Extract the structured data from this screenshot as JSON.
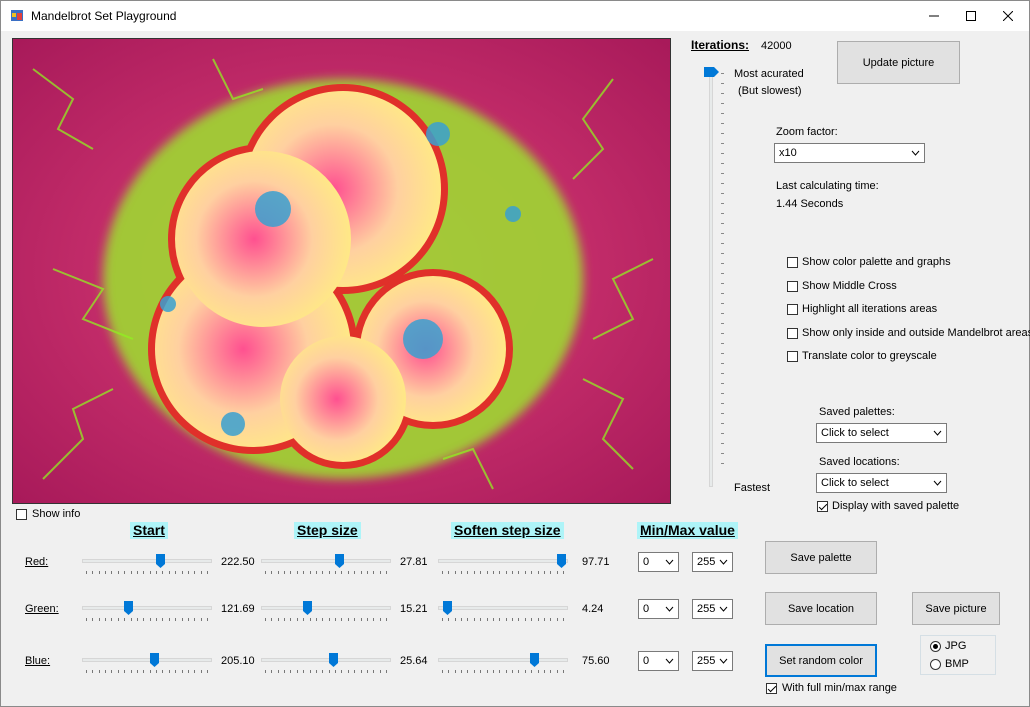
{
  "window": {
    "title": "Mandelbrot Set Playground"
  },
  "iterations": {
    "label": "Iterations:",
    "value": "42000",
    "most": "Most acurated",
    "slowest": "(But slowest)",
    "fastest": "Fastest",
    "level": 1.0
  },
  "update_button": "Update picture",
  "zoom": {
    "label": "Zoom factor:",
    "value": "x10"
  },
  "calc": {
    "label": "Last calculating time:",
    "value": "1.44 Seconds"
  },
  "options": [
    {
      "label": "Show color palette and graphs",
      "checked": false
    },
    {
      "label": "Show Middle Cross",
      "checked": false
    },
    {
      "label": "Highlight all iterations areas",
      "checked": false
    },
    {
      "label": "Show only inside and outside Mandelbrot areas",
      "checked": false
    },
    {
      "label": "Translate color to greyscale",
      "checked": false
    }
  ],
  "saved_palettes": {
    "label": "Saved palettes:",
    "value": "Click to select"
  },
  "saved_locations": {
    "label": "Saved locations:",
    "value": "Click to select"
  },
  "display_saved_palette": {
    "label": "Display with saved palette",
    "checked": true
  },
  "show_info": {
    "label": "Show info",
    "checked": false
  },
  "headers": {
    "start": "Start",
    "step": "Step size",
    "soften": "Soften step size",
    "minmax": "Min/Max value"
  },
  "channels": [
    {
      "name": "Red:",
      "start": "222.50",
      "start_level": 0.61,
      "step": "27.81",
      "step_level": 0.61,
      "soften": "97.71",
      "soften_level": 0.98,
      "min": "0",
      "max": "255"
    },
    {
      "name": "Green:",
      "start": "121.69",
      "start_level": 0.35,
      "step": "15.21",
      "step_level": 0.35,
      "soften": "4.24",
      "soften_level": 0.04,
      "min": "0",
      "max": "255"
    },
    {
      "name": "Blue:",
      "start": "205.10",
      "start_level": 0.56,
      "step": "25.64",
      "step_level": 0.56,
      "soften": "75.60",
      "soften_level": 0.76,
      "min": "0",
      "max": "255"
    }
  ],
  "buttons": {
    "save_palette": "Save  palette",
    "save_location": "Save location",
    "save_picture": "Save picture",
    "random_color": "Set random color"
  },
  "full_range": {
    "label": "With full min/max range",
    "checked": true
  },
  "format": {
    "jpg": "JPG",
    "bmp": "BMP",
    "selected": "JPG"
  },
  "colors": {
    "accent": "#0078d7",
    "header_bg": "#aef4f8",
    "fractal_outer": "#b02060",
    "fractal_green": "#7fe020",
    "fractal_yellow": "#ffe070"
  }
}
